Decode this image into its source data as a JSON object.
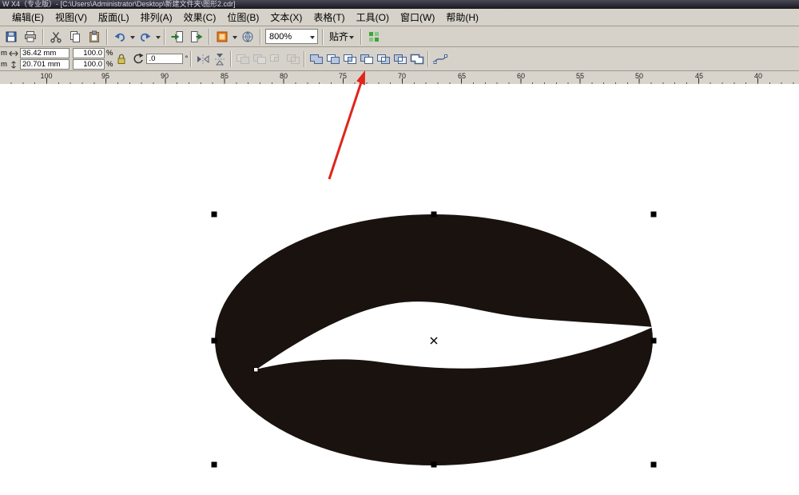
{
  "window": {
    "title": "W X4（专业版）- [C:\\Users\\Administrator\\Desktop\\新建文件夹\\图形2.cdr]"
  },
  "menu": {
    "items": [
      "编辑(E)",
      "视图(V)",
      "版面(L)",
      "排列(A)",
      "效果(C)",
      "位图(B)",
      "文本(X)",
      "表格(T)",
      "工具(O)",
      "窗口(W)",
      "帮助(H)"
    ]
  },
  "toolbar": {
    "zoom_value": "800%",
    "snap_label": "贴齐"
  },
  "propbar": {
    "clip_top": "m",
    "clip_bottom": "m",
    "width_value": "36.42 mm",
    "height_value": "20.701 mm",
    "scale_h": "100.0",
    "scale_v": "100.0",
    "percent": "%",
    "rotation_value": ".0",
    "degree": "°"
  },
  "ruler": {
    "labels": [
      "100",
      "95",
      "90",
      "85",
      "80",
      "75",
      "70",
      "65",
      "60",
      "55",
      "50",
      "45",
      "40"
    ]
  },
  "colors": {
    "shape_fill": "#19120e",
    "crease_fill": "#ffffff",
    "arrow": "#e0251b"
  }
}
